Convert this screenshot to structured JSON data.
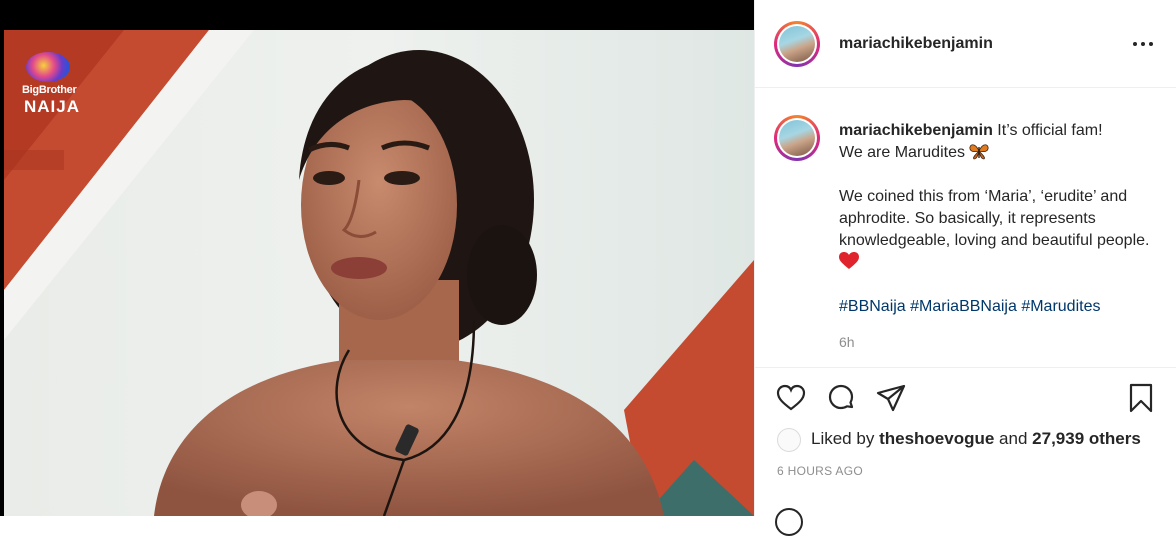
{
  "media": {
    "logo_line1": "BigBrother",
    "logo_line2": "NAIJA"
  },
  "header": {
    "username": "mariachikebenjamin",
    "more_icon": "more-horizontal-icon"
  },
  "caption": {
    "username": "mariachikebenjamin",
    "line1": "It’s official fam!",
    "line2": "We are Marudites",
    "line2_emoji": "butterfly",
    "paragraph": "We coined this from ‘Maria’, ‘erudite’ and aphrodite. So basically, it represents knowledgeable, loving and beautiful people.",
    "paragraph_emoji": "red-heart",
    "hashtags": [
      "#BBNaija",
      "#MariaBBNaija",
      "#Marudites"
    ],
    "time_ago": "6h"
  },
  "actions": {
    "like_icon": "heart-icon",
    "comment_icon": "comment-icon",
    "share_icon": "share-icon",
    "save_icon": "bookmark-icon"
  },
  "likes": {
    "prefix": "Liked by",
    "liker": "theshoevogue",
    "middle": "and",
    "count": "27,939 others"
  },
  "timestamp": "6 HOURS AGO",
  "colors": {
    "text": "#262626",
    "muted": "#8e8e8e",
    "hashtag": "#00376b",
    "border": "#efefef"
  }
}
